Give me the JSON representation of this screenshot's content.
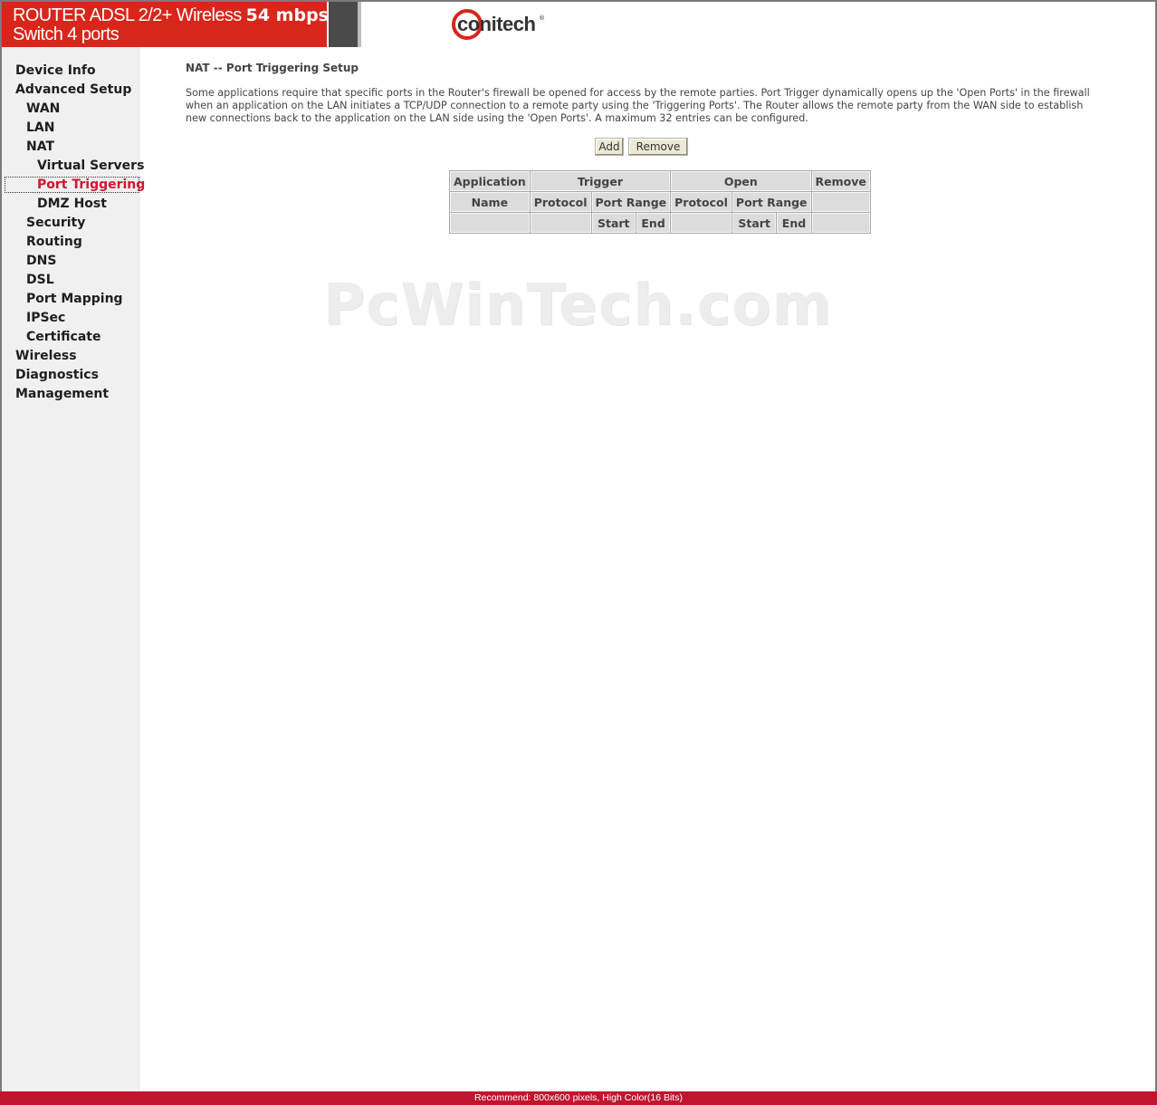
{
  "header": {
    "banner_line1_prefix": "ROUTER ADSL 2/2+ Wireless ",
    "banner_line1_bold": "54 mbps",
    "banner_line2": "Switch 4 ports",
    "logo_text": "conitech",
    "logo_mark": "®",
    "brand_red": "#d8261b"
  },
  "sidebar": {
    "items": [
      {
        "label": "Device Info"
      },
      {
        "label": "Advanced Setup"
      },
      {
        "label": "WAN"
      },
      {
        "label": "LAN"
      },
      {
        "label": "NAT"
      },
      {
        "label": "Virtual Servers"
      },
      {
        "label": "Port Triggering"
      },
      {
        "label": "DMZ Host"
      },
      {
        "label": "Security"
      },
      {
        "label": "Routing"
      },
      {
        "label": "DNS"
      },
      {
        "label": "DSL"
      },
      {
        "label": "Port Mapping"
      },
      {
        "label": "IPSec"
      },
      {
        "label": "Certificate"
      },
      {
        "label": "Wireless"
      },
      {
        "label": "Diagnostics"
      },
      {
        "label": "Management"
      }
    ],
    "active_color": "#d31332"
  },
  "main": {
    "title": "NAT -- Port Triggering Setup",
    "description": "Some applications require that specific ports in the Router's firewall be opened for access by the remote parties. Port Trigger dynamically opens up the 'Open Ports' in the firewall\nwhen an application on the LAN initiates a TCP/UDP connection to a remote party using the 'Triggering Ports'. The Router allows the remote party from the WAN side to establish\nnew connections back to the application on the LAN side using the 'Open Ports'. A maximum 32 entries can be configured.",
    "add_label": "Add",
    "remove_label": "Remove",
    "table": {
      "application": "Application",
      "trigger": "Trigger",
      "open": "Open",
      "remove": "Remove",
      "name": "Name",
      "trigger_protocol": "Protocol",
      "trigger_port_range": "Port Range",
      "open_protocol": "Protocol",
      "open_port_range": "Port Range",
      "trigger_start": "Start",
      "trigger_end": "End",
      "open_start": "Start",
      "open_end": "End"
    }
  },
  "watermark": "PcWinTech.com",
  "footer": {
    "text": "Recommend: 800x600 pixels, High Color(16 Bits)",
    "color": "#c0152f"
  }
}
